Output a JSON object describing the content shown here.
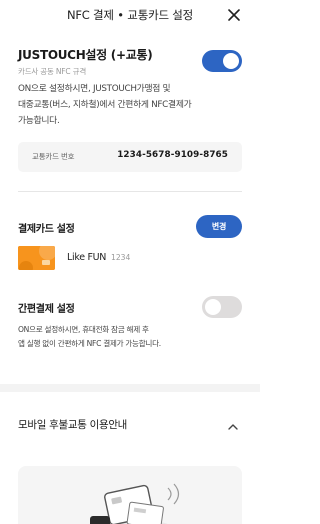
{
  "header": {
    "title": "NFC 결제 • 교통카드 설정",
    "close_icon": "close-icon"
  },
  "justouch": {
    "title": "JUSTOUCH설정 (+교통)",
    "subtitle": "카드사 공동 NFC 규격",
    "toggle_on": true,
    "desc_line1": "ON으로 설정하시면, JUSTOUCH가맹점 및",
    "desc_line2": "대중교통(버스, 지하철)에서 간편하게 NFC결제가",
    "desc_line3": "가능합니다."
  },
  "transit_card": {
    "label": "교통카드 번호",
    "number": "1234-5678-9109-8765"
  },
  "payment_card": {
    "title": "결제카드 설정",
    "change_label": "변경",
    "card_name": "Like FUN",
    "card_last4": "1234"
  },
  "easy_pay": {
    "title": "간편결제 설정",
    "toggle_on": false,
    "desc_line1": "ON으로 설정하시면, 휴대전화 잠금 해제 후",
    "desc_line2": "앱 실행 없이 간편하게 NFC 결제가 가능합니다."
  },
  "mobile_guide": {
    "title": "모바일 후불교통 이용안내",
    "expanded": true,
    "chevron_icon": "chevron-up-icon"
  },
  "colors": {
    "accent": "#2d65c3",
    "toggle_off": "#dedcdc",
    "card": "#f7941d"
  }
}
